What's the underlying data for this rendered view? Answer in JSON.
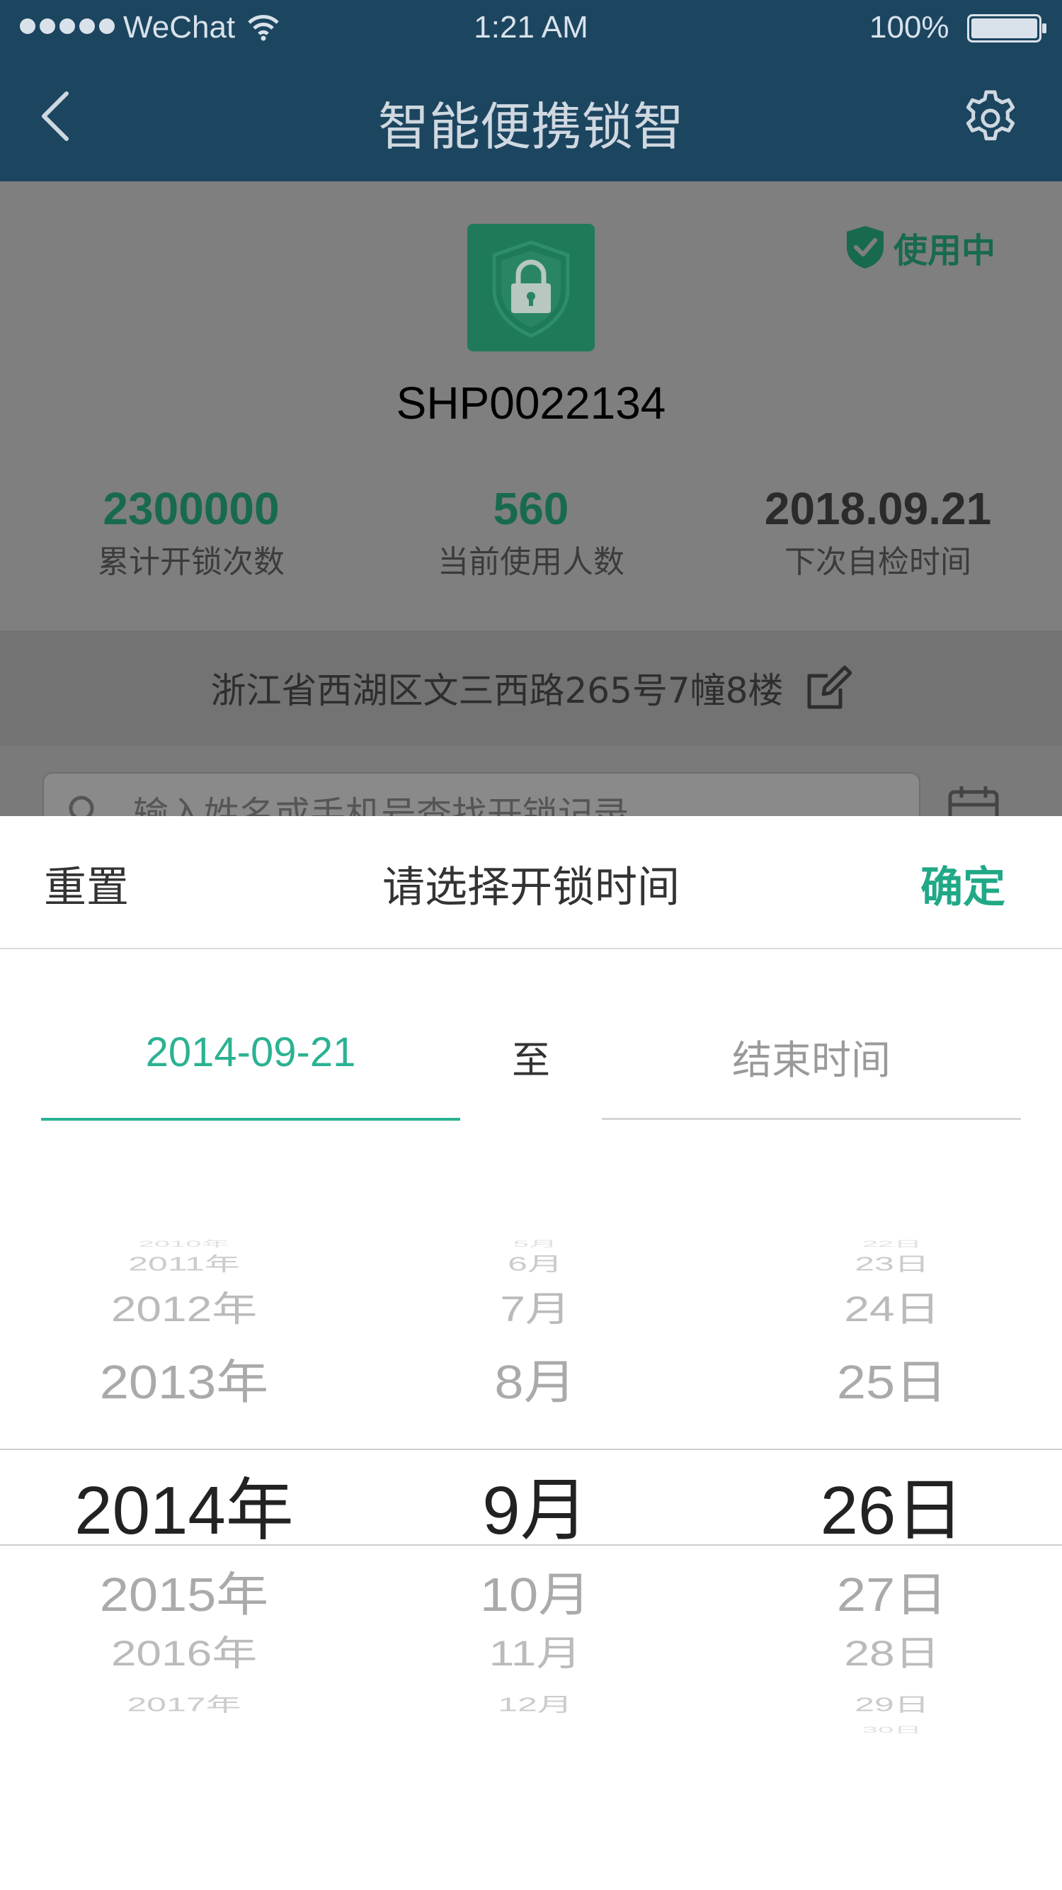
{
  "status_bar": {
    "carrier": "WeChat",
    "time": "1:21 AM",
    "battery": "100%",
    "icons": [
      "signal-dots-icon",
      "wifi-icon",
      "battery-icon"
    ]
  },
  "nav": {
    "title": "智能便携锁智",
    "icons": [
      "back-icon",
      "gear-icon"
    ]
  },
  "device": {
    "icon": "lock-shield-icon",
    "status": "使用中",
    "id": "SHP0022134",
    "stats": [
      {
        "value": "2300000",
        "label": "累计开锁次数"
      },
      {
        "value": "560",
        "label": "当前使用人数"
      },
      {
        "value": "2018.09.21",
        "label": "下次自检时间"
      }
    ],
    "address": "浙江省西湖区文三西路265号7幢8楼"
  },
  "search": {
    "placeholder": "输入姓名或手机号查找开锁记录"
  },
  "sheet": {
    "reset_label": "重置",
    "title": "请选择开锁时间",
    "confirm_label": "确定",
    "start_date": "2014-09-21",
    "separator": "至",
    "end_placeholder": "结束时间"
  },
  "picker": {
    "years": [
      "2010年",
      "2011年",
      "2012年",
      "2013年",
      "2014年",
      "2015年",
      "2016年",
      "2017年"
    ],
    "months": [
      "5月",
      "6月",
      "7月",
      "8月",
      "9月",
      "10月",
      "11月",
      "12月"
    ],
    "days": [
      "22日",
      "23日",
      "24日",
      "25日",
      "26日",
      "27日",
      "28日",
      "29日",
      "30日"
    ],
    "selected": {
      "year": "2014年",
      "month": "9月",
      "day": "26日"
    }
  },
  "colors": {
    "nav_background": "#1c4560",
    "accent": "#2bb292",
    "dim_green": "#186a4e"
  }
}
